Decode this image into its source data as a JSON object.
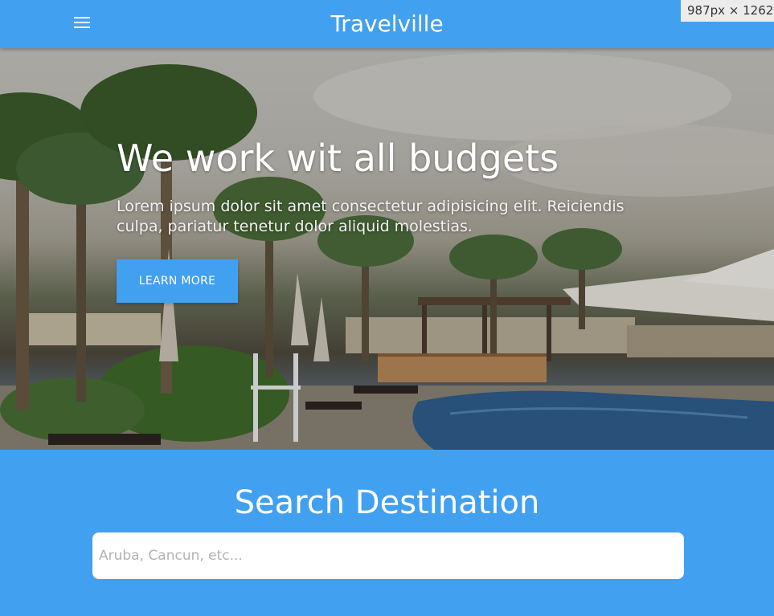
{
  "navbar": {
    "brand": "Travelville",
    "menu_icon": "hamburger-menu-icon",
    "background": "#42a0f0"
  },
  "devtools": {
    "dimensions": "987px × 1262px"
  },
  "hero": {
    "title": "We work wit all budgets",
    "text": "Lorem ipsum dolor sit amet consectetur adipisicing elit. Reiciendis culpa, pariatur tenetur dolor aliquid molestias.",
    "button_label": "LEARN MORE"
  },
  "search": {
    "title": "Search Destination",
    "placeholder": "Aruba, Cancun, etc...",
    "value": ""
  },
  "colors": {
    "accent": "#42a0f0",
    "text_light": "#ffffff"
  }
}
